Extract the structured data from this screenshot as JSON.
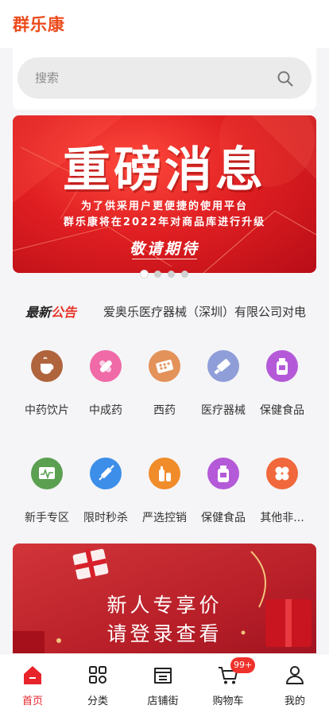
{
  "app": {
    "brand": "群乐康",
    "brand_color": "#ec4b1c"
  },
  "search": {
    "placeholder": "搜索"
  },
  "banner": {
    "title": "重磅消息",
    "line1": "为了供采用户更便捷的使用平台",
    "line2": "群乐康将在2022年对商品库进行升级",
    "tagline": "敬请期待",
    "slide_count": 4,
    "active_slide": 1
  },
  "notice": {
    "logo_part1": "最新",
    "logo_part2": "公告",
    "text": "爱奥乐医疗器械（深圳）有限公司对电"
  },
  "categories_row1": [
    {
      "label": "中药饮片",
      "icon": "tea-cup-icon",
      "color": "#b0643c"
    },
    {
      "label": "中成药",
      "icon": "capsule-icon",
      "color": "#f06aa8"
    },
    {
      "label": "西药",
      "icon": "tablet-pack-icon",
      "color": "#e3925a"
    },
    {
      "label": "医疗器械",
      "icon": "ointment-tube-icon",
      "color": "#8f9ed8"
    },
    {
      "label": "保健食品",
      "icon": "supplement-bottle-icon",
      "color": "#b45ad8"
    }
  ],
  "categories_row2": [
    {
      "label": "新手专区",
      "icon": "monitor-icon",
      "color": "#5aa050"
    },
    {
      "label": "限时秒杀",
      "icon": "syringe-icon",
      "color": "#3c8ee8"
    },
    {
      "label": "严选控销",
      "icon": "bottles-icon",
      "color": "#f08c2a"
    },
    {
      "label": "保健食品",
      "icon": "supplement-bottle-icon",
      "color": "#b45ad8"
    },
    {
      "label": "其他非...",
      "icon": "clover-icon",
      "color": "#f0683c"
    }
  ],
  "promo": {
    "line1": "新人专享价",
    "line2": "请登录查看"
  },
  "tabbar": {
    "active_color": "#e8242b",
    "items": [
      {
        "label": "首页",
        "icon": "home-icon"
      },
      {
        "label": "分类",
        "icon": "grid-icon"
      },
      {
        "label": "店铺街",
        "icon": "shop-icon"
      },
      {
        "label": "购物车",
        "icon": "cart-icon",
        "badge": "99+"
      },
      {
        "label": "我的",
        "icon": "user-icon"
      }
    ]
  }
}
